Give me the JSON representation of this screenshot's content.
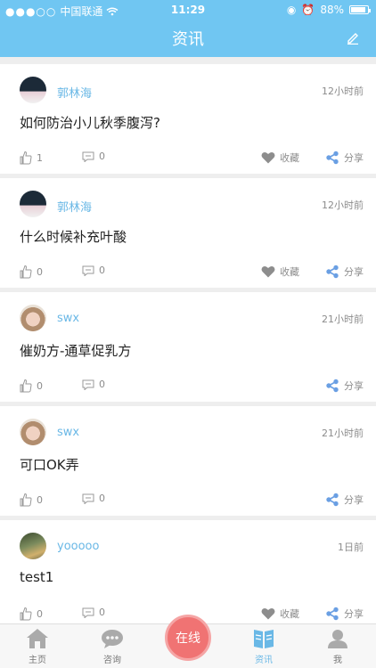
{
  "status_bar": {
    "carrier": "中国联通",
    "time": "11:29",
    "battery": "88%"
  },
  "header": {
    "title": "资讯"
  },
  "posts": [
    {
      "user": "郭林海",
      "time": "12小时前",
      "title": "如何防治小儿秋季腹泻?",
      "likes": "1",
      "comments": "0",
      "fav_label": "收藏",
      "share_label": "分享"
    },
    {
      "user": "郭林海",
      "time": "12小时前",
      "title": "什么时候补充叶酸",
      "likes": "0",
      "comments": "0",
      "fav_label": "收藏",
      "share_label": "分享"
    },
    {
      "user": "swx",
      "time": "21小时前",
      "title": "催奶方-通草促乳方",
      "likes": "0",
      "comments": "0",
      "share_label": "分享"
    },
    {
      "user": "swx",
      "time": "21小时前",
      "title": "可口OK弄",
      "likes": "0",
      "comments": "0",
      "share_label": "分享"
    },
    {
      "user": "yooooo",
      "time": "1日前",
      "title": "test1",
      "likes": "0",
      "comments": "0",
      "fav_label": "收藏",
      "share_label": "分享"
    }
  ],
  "tabbar": {
    "home": "主页",
    "consult": "咨询",
    "online": "在线",
    "news": "资讯",
    "me": "我"
  },
  "colors": {
    "header": "#70c6f2",
    "accent": "#6ab8e6",
    "online_button": "#f07373"
  },
  "icons": [
    "wifi-icon",
    "edit-icon",
    "thumb-up-icon",
    "comment-icon",
    "heart-icon",
    "share-icon",
    "home-icon",
    "chat-icon",
    "news-icon",
    "user-icon"
  ]
}
